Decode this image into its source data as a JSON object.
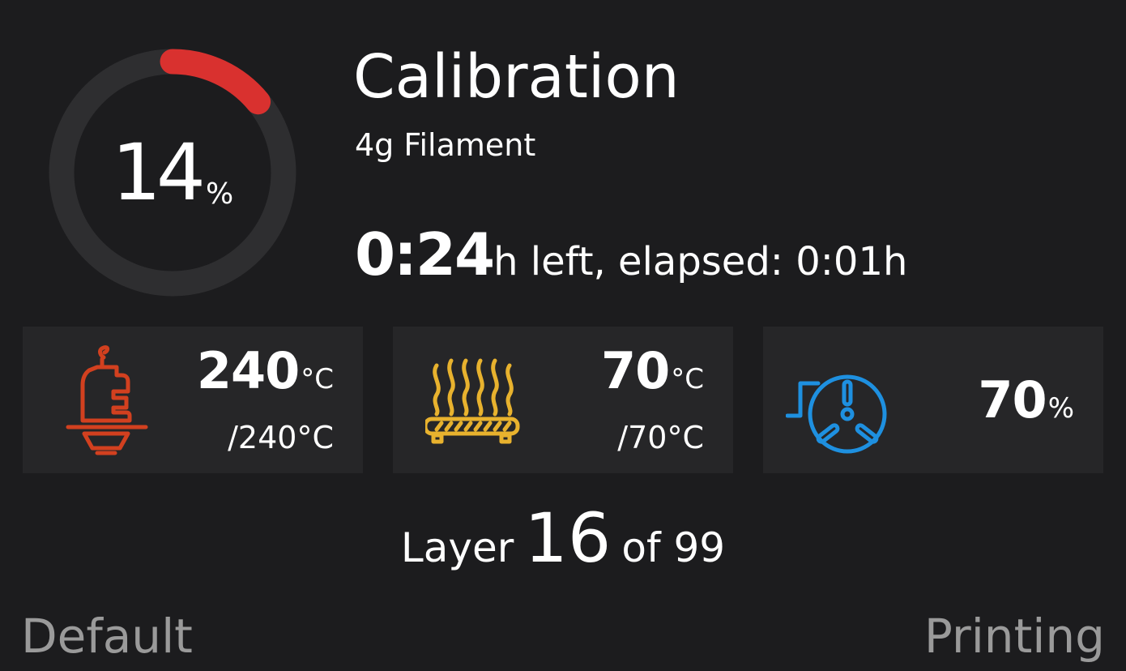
{
  "progress": {
    "percent": 14,
    "value_text": "14",
    "unit": "%",
    "track_color": "#2e2e30",
    "fill_color": "#d9312f"
  },
  "job": {
    "title": "Calibration",
    "filament": "4g Filament",
    "time_left": "0:24",
    "time_rest": "h left, elapsed: 0:01h"
  },
  "nozzle": {
    "icon": "nozzle-icon",
    "color": "#d2401f",
    "temp": "240",
    "unit": "°C",
    "target": "/240°C"
  },
  "bed": {
    "icon": "heatbed-icon",
    "color": "#e8b22e",
    "temp": "70",
    "unit": "°C",
    "target": "/70°C"
  },
  "fan": {
    "icon": "fan-icon",
    "color": "#1e90e0",
    "value": "70",
    "unit": "%"
  },
  "layer": {
    "prefix": "Layer",
    "current": "16",
    "suffix": "of 99"
  },
  "footer": {
    "left": "Default",
    "right": "Printing"
  }
}
